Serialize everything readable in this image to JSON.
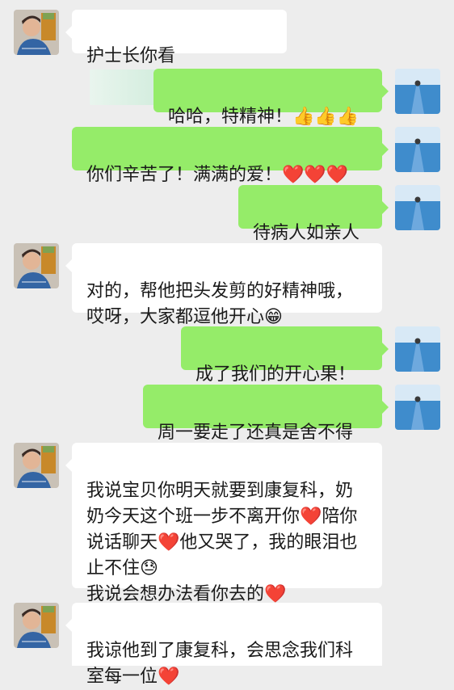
{
  "colors": {
    "background": "#ededed",
    "incoming_bubble": "#ffffff",
    "outgoing_bubble": "#95ec69"
  },
  "messages": [
    {
      "side": "left",
      "text": "护士长你看"
    },
    {
      "side": "right",
      "text": "哈哈，特精神！👍👍👍"
    },
    {
      "side": "right",
      "text": "你们辛苦了！满满的爱！❤️❤️❤️"
    },
    {
      "side": "right",
      "text": "待病人如亲人"
    },
    {
      "side": "left",
      "text": "对的，帮他把头发剪的好精神哦，\n哎呀，大家都逗他开心😁"
    },
    {
      "side": "right",
      "text": "成了我们的开心果！"
    },
    {
      "side": "right",
      "text": "周一要走了还真是舍不得"
    },
    {
      "side": "left",
      "text": "我说宝贝你明天就要到康复科，奶\n奶今天这个班一步不离开你❤️陪你\n说话聊天❤️他又哭了，我的眼泪也\n止不住😓\n我说会想办法看你去的❤️"
    },
    {
      "side": "left",
      "text": "我谅他到了康复科，会思念我们科\n室每一位❤️"
    }
  ]
}
